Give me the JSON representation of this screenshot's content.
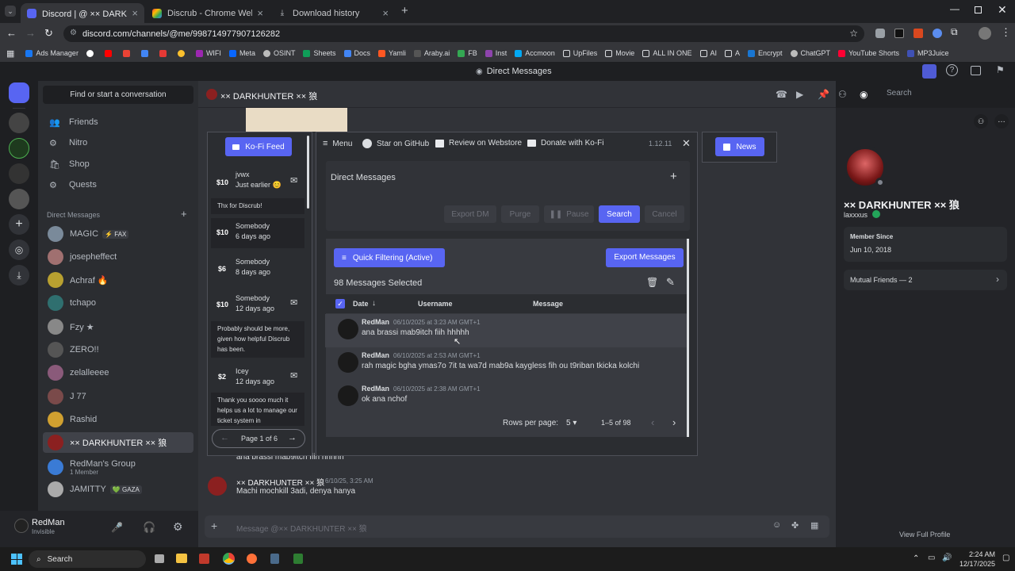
{
  "browser": {
    "tabs": [
      {
        "title": "Discord | @ ×× DARKHUNTER × 狼",
        "active": true
      },
      {
        "title": "Discrub - Chrome Web Store",
        "active": false
      },
      {
        "title": "Download history",
        "active": false
      }
    ],
    "url": "discord.com/channels/@me/998714977907126282",
    "bookmarks": [
      "Ads Manager",
      "WIFI",
      "Meta",
      "OSINT",
      "Sheets",
      "Docs",
      "Yamli",
      "Araby.ai",
      "FB",
      "Inst",
      "Accmoon",
      "UpFiles",
      "Movie",
      "ALL IN ONE",
      "AI",
      "A",
      "Encrypt",
      "ChatGPT",
      "YouTube Shorts",
      "MP3Juice"
    ]
  },
  "discord": {
    "window_title": "Direct Messages",
    "search_convo": "Find or start a conversation",
    "nav": [
      "Friends",
      "Nitro",
      "Shop",
      "Quests"
    ],
    "dm_header": "Direct Messages",
    "dms": [
      {
        "name": "MAGIC",
        "tag": "⚡ FAX",
        "color": "#7a8a9a"
      },
      {
        "name": "josepheffect",
        "color": "#a07070"
      },
      {
        "name": "Achraf 🔥",
        "color": "#b8a030"
      },
      {
        "name": "tchapo",
        "color": "#2f6f6f"
      },
      {
        "name": "Fzy ★",
        "color": "#888888"
      },
      {
        "name": "ZERO!!",
        "color": "#555555"
      },
      {
        "name": "zelalleeee",
        "color": "#8a5a7a"
      },
      {
        "name": "J 77",
        "color": "#7a4a4a"
      },
      {
        "name": "Rashid",
        "color": "#d0a030"
      },
      {
        "name": "×× DARKHUNTER ×× 狼",
        "color": "#8b2020",
        "active": true
      },
      {
        "name": "RedMan's Group",
        "sub": "1 Member",
        "color": "#3a7bd5"
      },
      {
        "name": "JAMITTY",
        "tag": "💚 GAZA",
        "color": "#aaaaaa"
      }
    ],
    "user": {
      "name": "RedMan",
      "status": "Invisible"
    },
    "chat_title": "×× DARKHUNTER ×× 狼",
    "chat_search": "Search",
    "chat_messages": [
      {
        "text": "ana brassi mab9itch fiih hhhhh"
      },
      {
        "author": "×× DARKHUNTER ×× 狼",
        "time": "6/10/25, 3:25 AM",
        "text": "Machi mochkill 3adi, denya hanya"
      }
    ],
    "composer_placeholder": "Message @×× DARKHUNTER ×× 狼",
    "profile": {
      "display": "×× DARKHUNTER ×× 狼",
      "username": "laxxxus",
      "member_since_label": "Member Since",
      "member_since": "Jun 10, 2018",
      "mutual": "Mutual Friends — 2",
      "view_full": "View Full Profile"
    }
  },
  "kofi": {
    "button": "Ko-Fi Feed",
    "items": [
      {
        "amount": "$10",
        "name": "jvwx",
        "when": "Just earlier 😊",
        "message": "Thx for Discrub!"
      },
      {
        "amount": "$10",
        "name": "Somebody",
        "when": "6 days ago"
      },
      {
        "amount": "$6",
        "name": "Somebody",
        "when": "8 days ago"
      },
      {
        "amount": "$10",
        "name": "Somebody",
        "when": "12 days ago",
        "message": "Probably should be more, given how helpful Discrub has been."
      },
      {
        "amount": "$2",
        "name": "Icey",
        "when": "12 days ago",
        "message": "Thank you soooo much it helps us a lot to manage our ticket system in"
      }
    ],
    "page": "Page 1 of 6"
  },
  "discrub": {
    "menu": "Menu",
    "github": "Star on GitHub",
    "webstore": "Review on Webstore",
    "donate": "Donate with Ko-Fi",
    "version": "1.12.11",
    "section": "Direct Messages",
    "buttons": {
      "export_dm": "Export DM",
      "purge": "Purge",
      "pause": "Pause",
      "search": "Search",
      "cancel": "Cancel"
    },
    "quick_filter": "Quick Filtering (Active)",
    "export_messages": "Export Messages",
    "selected": "98 Messages Selected",
    "columns": {
      "date": "Date",
      "username": "Username",
      "message": "Message"
    },
    "rows": [
      {
        "user": "RedMan",
        "time": "06/10/2025 at 3:23 AM GMT+1",
        "text": "ana brassi mab9itch fiih hhhhh"
      },
      {
        "user": "RedMan",
        "time": "06/10/2025 at 2:53 AM GMT+1",
        "text": "rah magic bgha ymas7o 7it ta wa7d mab9a kaygless fih ou t9riban tkicka kolchi"
      },
      {
        "user": "RedMan",
        "time": "06/10/2025 at 2:38 AM GMT+1",
        "text": "ok ana nchof"
      }
    ],
    "rows_per_page_label": "Rows per page:",
    "rows_per_page": "5",
    "range": "1–5 of 98",
    "news": "News"
  },
  "taskbar": {
    "search": "Search",
    "time": "2:24 AM",
    "date": "12/17/2025"
  }
}
